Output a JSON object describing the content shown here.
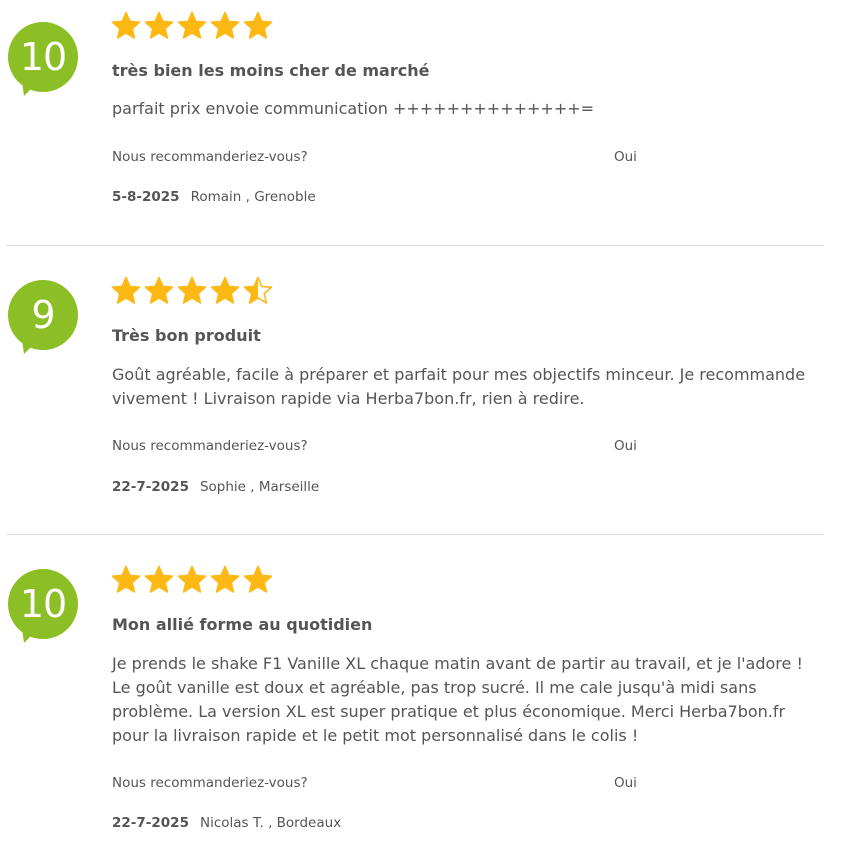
{
  "colors": {
    "accent": "#8cbf26",
    "star": "#fdb813",
    "text": "#555555",
    "divider": "#d9d9d9"
  },
  "recommend_question": "Nous recommanderiez-vous?",
  "reviews": [
    {
      "score": "10",
      "rating": 5,
      "title": "très bien les moins cher de marché",
      "body": "parfait prix envoie communication ++++++++++++++=",
      "recommend_answer": "Oui",
      "date": "5-8-2025",
      "author": "Romain , Grenoble"
    },
    {
      "score": "9",
      "rating": 4.5,
      "title": "Très bon produit",
      "body": "Goût agréable, facile à préparer et parfait pour mes objectifs minceur. Je recommande vivement ! Livraison rapide via Herba7bon.fr, rien à redire.",
      "recommend_answer": "Oui",
      "date": "22-7-2025",
      "author": "Sophie , Marseille"
    },
    {
      "score": "10",
      "rating": 5,
      "title": "Mon allié forme au quotidien",
      "body": "Je prends le shake F1 Vanille XL chaque matin avant de partir au travail, et je l'adore ! Le goût vanille est doux et agréable, pas trop sucré. Il me cale jusqu'à midi sans problème. La version XL est super pratique et plus économique. Merci Herba7bon.fr pour la livraison rapide et le petit mot personnalisé dans le colis !",
      "recommend_answer": "Oui",
      "date": "22-7-2025",
      "author": "Nicolas T. , Bordeaux"
    }
  ]
}
